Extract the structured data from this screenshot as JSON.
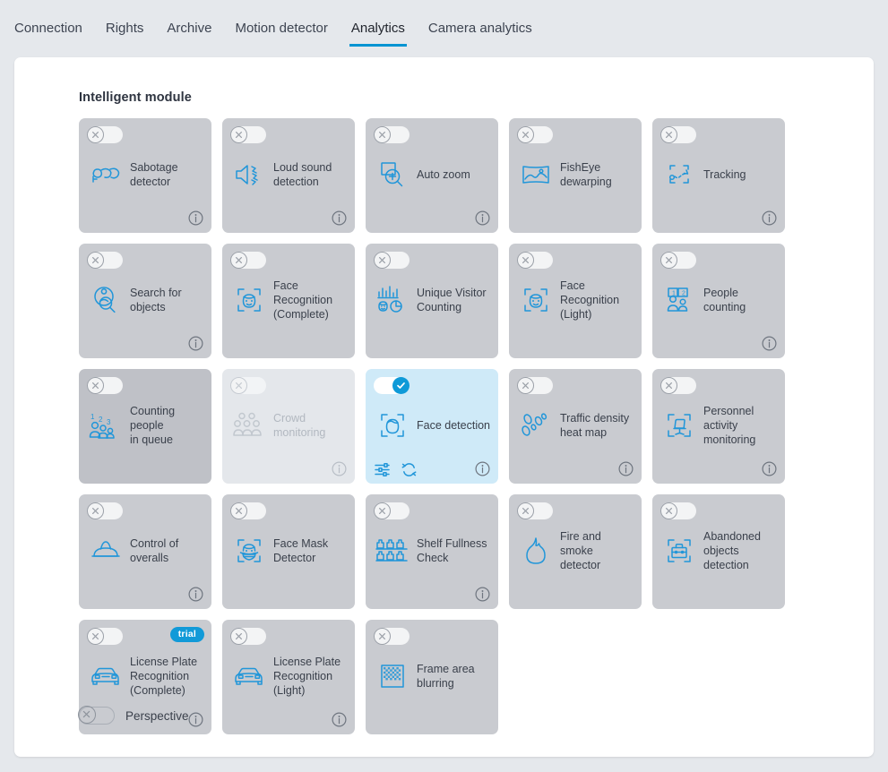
{
  "tabs": [
    {
      "label": "Connection",
      "active": false
    },
    {
      "label": "Rights",
      "active": false
    },
    {
      "label": "Archive",
      "active": false
    },
    {
      "label": "Motion detector",
      "active": false
    },
    {
      "label": "Analytics",
      "active": true
    },
    {
      "label": "Camera analytics",
      "active": false
    }
  ],
  "panel": {
    "title": "Intelligent module"
  },
  "colors": {
    "accent": "#0094d2",
    "icon_blue": "#2196d9",
    "card_bg": "#c9cbd0",
    "card_bg_hover": "#bfc1c7",
    "card_bg_disabled": "#e4e7eb",
    "card_bg_selected": "#cfeaf8",
    "badge_bg": "#119ad8",
    "page_bg": "#e5e8ec"
  },
  "modules": [
    {
      "label": "Sabotage\ndetector",
      "icon": "sabotage-detector-icon",
      "state": "off",
      "info": true,
      "badge": null
    },
    {
      "label": "Loud sound\ndetection",
      "icon": "loud-sound-icon",
      "state": "off",
      "info": true,
      "badge": null
    },
    {
      "label": "Auto zoom",
      "icon": "auto-zoom-icon",
      "state": "off",
      "info": true,
      "badge": null
    },
    {
      "label": "FishEye\ndewarping",
      "icon": "fisheye-dewarping-icon",
      "state": "off",
      "info": false,
      "badge": null
    },
    {
      "label": "Tracking",
      "icon": "tracking-icon",
      "state": "off",
      "info": true,
      "badge": null
    },
    {
      "label": "Search for\nobjects",
      "icon": "search-objects-icon",
      "state": "off",
      "info": true,
      "badge": null
    },
    {
      "label": "Face\nRecognition\n(Complete)",
      "icon": "face-recognition-icon",
      "state": "off",
      "info": false,
      "badge": null
    },
    {
      "label": "Unique Visitor\nCounting",
      "icon": "unique-visitor-counting-icon",
      "state": "off",
      "info": false,
      "badge": null
    },
    {
      "label": "Face\nRecognition\n(Light)",
      "icon": "face-recognition-icon",
      "state": "off",
      "info": false,
      "badge": null
    },
    {
      "label": "People counting",
      "icon": "people-counting-icon",
      "state": "off",
      "info": true,
      "badge": null
    },
    {
      "label": "Counting people\nin queue",
      "icon": "counting-queue-icon",
      "state": "hover",
      "info": false,
      "badge": null
    },
    {
      "label": "Crowd\nmonitoring",
      "icon": "crowd-monitoring-icon",
      "state": "disabled",
      "info": true,
      "badge": null
    },
    {
      "label": "Face detection",
      "icon": "face-detection-icon",
      "state": "selected",
      "info": true,
      "badge": null,
      "actions": [
        "settings-sliders-icon",
        "refresh-icon"
      ]
    },
    {
      "label": "Traffic density\nheat map",
      "icon": "traffic-heatmap-icon",
      "state": "off",
      "info": true,
      "badge": null
    },
    {
      "label": "Personnel\nactivity\nmonitoring",
      "icon": "personnel-activity-icon",
      "state": "off",
      "info": true,
      "badge": null
    },
    {
      "label": "Control of\noveralls",
      "icon": "hard-hat-icon",
      "state": "off",
      "info": true,
      "badge": null
    },
    {
      "label": "Face Mask\nDetector",
      "icon": "face-mask-icon",
      "state": "off",
      "info": false,
      "badge": null
    },
    {
      "label": "Shelf Fullness\nCheck",
      "icon": "shelf-fullness-icon",
      "state": "off",
      "info": true,
      "badge": null
    },
    {
      "label": "Fire and smoke\ndetector",
      "icon": "fire-smoke-icon",
      "state": "off",
      "info": false,
      "badge": null
    },
    {
      "label": "Abandoned\nobjects\ndetection",
      "icon": "abandoned-objects-icon",
      "state": "off",
      "info": false,
      "badge": null
    },
    {
      "label": "License Plate\nRecognition\n(Complete)",
      "icon": "license-plate-icon",
      "state": "off",
      "info": true,
      "badge": "trial"
    },
    {
      "label": "License Plate\nRecognition\n(Light)",
      "icon": "license-plate-icon",
      "state": "off",
      "info": true,
      "badge": null
    },
    {
      "label": "Frame area\nblurring",
      "icon": "frame-blur-icon",
      "state": "off",
      "info": false,
      "badge": null
    }
  ],
  "perspective": {
    "label": "Perspective",
    "state": "off"
  }
}
